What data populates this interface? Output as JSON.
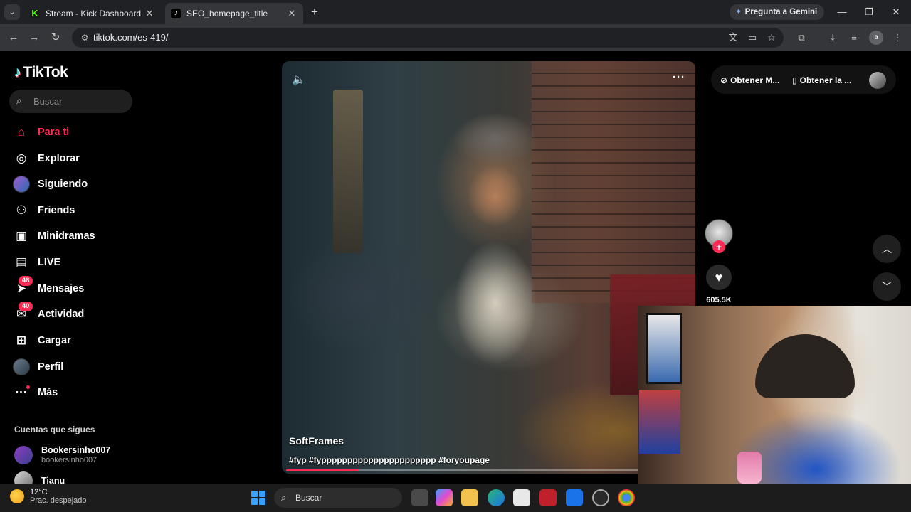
{
  "browser": {
    "tabs": [
      {
        "title": "Stream - Kick Dashboard",
        "favicon": "kick-icon"
      },
      {
        "title": "SEO_homepage_title",
        "favicon": "tiktok-icon"
      }
    ],
    "gemini_label": "Pregunta a Gemini",
    "url": "tiktok.com/es-419/",
    "profile_initial": "a"
  },
  "tiktok": {
    "logo": "TikTok",
    "search_placeholder": "Buscar",
    "nav": [
      {
        "label": "Para ti",
        "icon": "home-icon"
      },
      {
        "label": "Explorar",
        "icon": "compass-icon"
      },
      {
        "label": "Siguiendo",
        "icon": "following-avatar-icon"
      },
      {
        "label": "Friends",
        "icon": "friends-icon"
      },
      {
        "label": "Minidramas",
        "icon": "film-icon"
      },
      {
        "label": "LIVE",
        "icon": "live-tv-icon"
      },
      {
        "label": "Mensajes",
        "icon": "send-icon",
        "badge": "48"
      },
      {
        "label": "Actividad",
        "icon": "inbox-icon",
        "badge": "40"
      },
      {
        "label": "Cargar",
        "icon": "upload-plus-icon"
      },
      {
        "label": "Perfil",
        "icon": "profile-avatar-icon"
      },
      {
        "label": "Más",
        "icon": "more-dots-icon"
      }
    ],
    "following_title": "Cuentas que sigues",
    "following": [
      {
        "name": "Bookersinho007",
        "handle": "bookersinho007"
      },
      {
        "name": "Tianu",
        "handle": ""
      }
    ],
    "video": {
      "author": "SoftFrames",
      "description": "#fyp #fypppppppppppppppppppppp #foryoupage",
      "progress": 0.18
    },
    "top_actions": {
      "get_coins": "Obtener M...",
      "get_app": "Obtener la ..."
    },
    "like_count": "605.5K"
  },
  "taskbar": {
    "temperature": "12°C",
    "condition": "Prac. despejado",
    "search_placeholder": "Buscar"
  },
  "colors": {
    "accent": "#fe2c55",
    "background": "#000000",
    "chrome_dark": "#202124",
    "chrome_mid": "#35363a"
  }
}
